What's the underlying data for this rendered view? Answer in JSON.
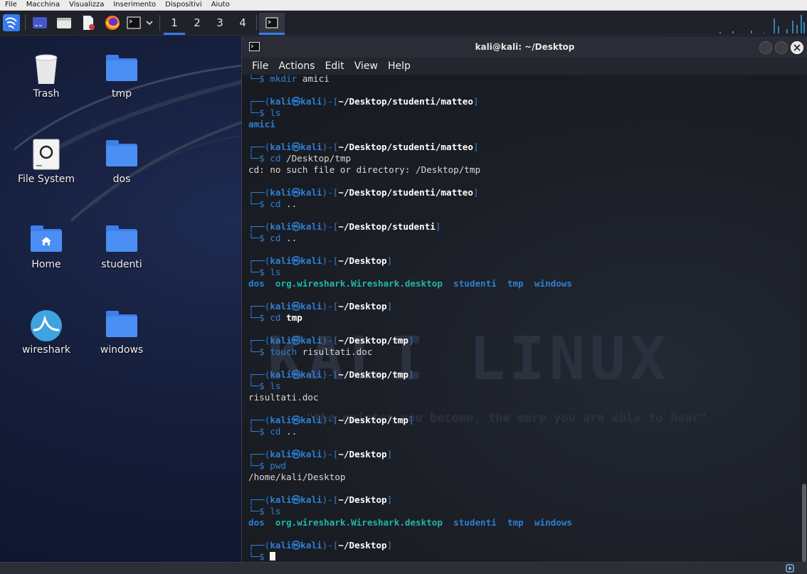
{
  "vm_menu": [
    "File",
    "Macchina",
    "Visualizza",
    "Inserimento",
    "Dispositivi",
    "Aiuto"
  ],
  "panel": {
    "workspaces": [
      "1",
      "2",
      "3",
      "4"
    ],
    "active_workspace": "1",
    "launchers": [
      "kali-menu-icon",
      "desktop-icon",
      "file-manager-icon",
      "text-editor-icon",
      "firefox-icon",
      "terminal-icon",
      "chevron-down-icon"
    ],
    "tasks": [
      "terminal-icon"
    ]
  },
  "desktop": {
    "icons": [
      {
        "label": "Trash",
        "icon": "trash-icon"
      },
      {
        "label": "tmp",
        "icon": "folder-icon"
      },
      {
        "label": "File System",
        "icon": "drive-icon"
      },
      {
        "label": "dos",
        "icon": "folder-icon"
      },
      {
        "label": "Home",
        "icon": "home-folder-icon"
      },
      {
        "label": "studenti",
        "icon": "folder-icon"
      },
      {
        "label": "wireshark",
        "icon": "wireshark-icon"
      },
      {
        "label": "windows",
        "icon": "folder-icon"
      }
    ]
  },
  "terminal": {
    "title": "kali@kali: ~/Desktop",
    "menu": [
      "File",
      "Actions",
      "Edit",
      "View",
      "Help"
    ],
    "watermark": {
      "brand": "KALI LINUX",
      "slogan": "\"the quieter you become, the more you are able to hear\""
    },
    "user": "kali",
    "host": "kali",
    "first_command": {
      "cmd": "mkdir",
      "args": "amici"
    },
    "blocks": [
      {
        "path": "~/Desktop/studenti/matteo",
        "cmd": "ls",
        "args": "",
        "output": [
          {
            "text": "amici",
            "kind": "dir"
          }
        ]
      },
      {
        "path": "~/Desktop/studenti/matteo",
        "cmd": "cd",
        "args": "/Desktop/tmp",
        "output_text": "cd: no such file or directory: /Desktop/tmp"
      },
      {
        "path": "~/Desktop/studenti/matteo",
        "cmd": "cd",
        "args": ".."
      },
      {
        "path": "~/Desktop/studenti",
        "cmd": "cd",
        "args": ".."
      },
      {
        "path": "~/Desktop",
        "cmd": "ls",
        "args": "",
        "output": [
          {
            "text": "dos",
            "kind": "dir"
          },
          {
            "text": "org.wireshark.Wireshark.desktop",
            "kind": "file"
          },
          {
            "text": "studenti",
            "kind": "dir"
          },
          {
            "text": "tmp",
            "kind": "dir"
          },
          {
            "text": "windows",
            "kind": "dir"
          }
        ]
      },
      {
        "path": "~/Desktop",
        "cmd": "cd",
        "args": "tmp",
        "bold_args": true
      },
      {
        "path": "~/Desktop/tmp",
        "cmd": "touch",
        "args": "risultati.doc"
      },
      {
        "path": "~/Desktop/tmp",
        "cmd": "ls",
        "args": "",
        "output_text": "risultati.doc"
      },
      {
        "path": "~/Desktop/tmp",
        "cmd": "cd",
        "args": ".."
      },
      {
        "path": "~/Desktop",
        "cmd": "pwd",
        "args": "",
        "output_text": "/home/kali/Desktop"
      },
      {
        "path": "~/Desktop",
        "cmd": "ls",
        "args": "",
        "output": [
          {
            "text": "dos",
            "kind": "dir"
          },
          {
            "text": "org.wireshark.Wireshark.desktop",
            "kind": "file"
          },
          {
            "text": "studenti",
            "kind": "dir"
          },
          {
            "text": "tmp",
            "kind": "dir"
          },
          {
            "text": "windows",
            "kind": "dir"
          }
        ]
      },
      {
        "path": "~/Desktop",
        "cmd": "",
        "args": "",
        "current": true
      }
    ]
  },
  "colors": {
    "prompt_blue": "#2d7fd4",
    "file_teal": "#1fb8a6",
    "folder_blue": "#3d7fe8"
  }
}
